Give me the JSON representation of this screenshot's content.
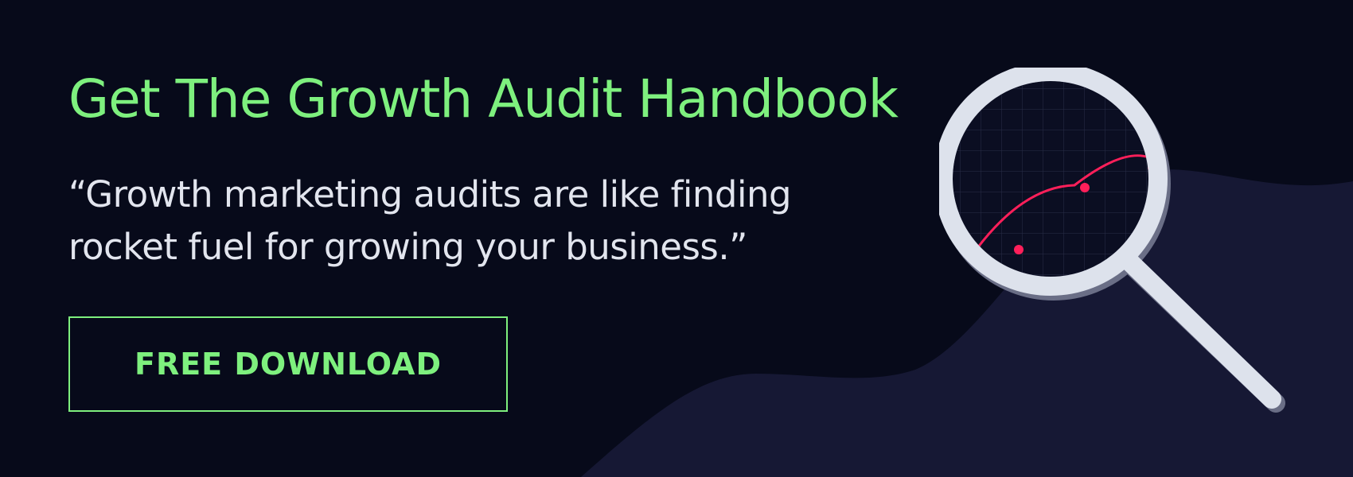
{
  "banner": {
    "title": "Get The Growth Audit Handbook",
    "quote_line_1": "“Growth marketing audits are like finding",
    "quote_line_2": "rocket fuel for growing your business.”",
    "cta_label": "FREE DOWNLOAD"
  },
  "colors": {
    "background": "#070a1a",
    "wave": "#161834",
    "accent_green": "#7ef07e",
    "quote_text": "#e2e5ee",
    "magnifier_frame": "#dde2ec",
    "lens_fill": "#0b0e22",
    "curve": "#ff1f5a"
  },
  "illustration": {
    "icon": "magnifying-glass-icon",
    "chart": "growth-curve"
  }
}
